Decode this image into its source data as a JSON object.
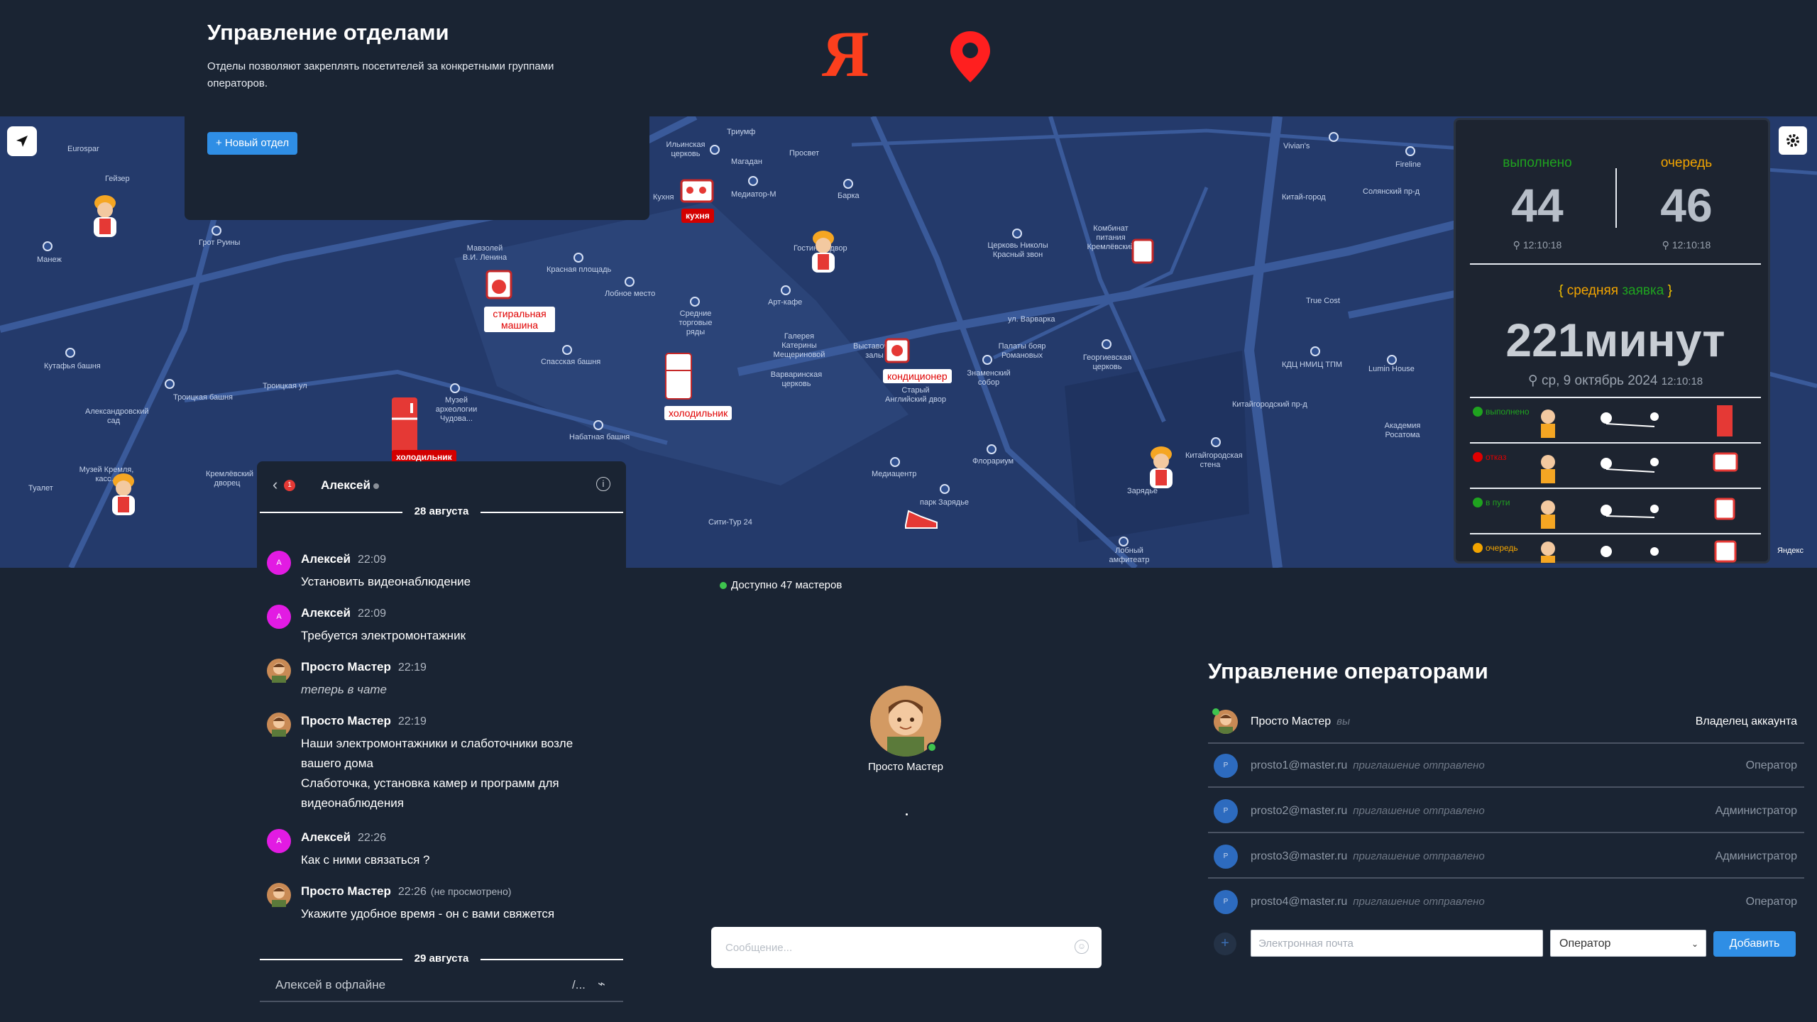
{
  "departments": {
    "title": "Управление отделами",
    "description": "Отделы позволяют закреплять посетителей за конкретными группами операторов.",
    "new_button": "+ Новый отдел"
  },
  "logos": {
    "yandex_letter": "Я"
  },
  "map": {
    "labels": [
      "Eurospar",
      "Гейзер",
      "Манеж",
      "Грот Руины",
      "Мавзолей В.И. Ленина",
      "Красная площадь",
      "Лобное место",
      "Средние торговые ряды",
      "Спасская башня",
      "Кутафья башня",
      "Александровский сад",
      "Троицкая башня",
      "Музей археологии Чудова...",
      "Набатная башня",
      "Музей Кремля, касс...",
      "Кремлёвский дворец",
      "Туалет",
      "Ильинская церковь",
      "Триумф",
      "Магадан",
      "Просвет",
      "Медиатор-М",
      "Барка",
      "Кухня",
      "Гостиный двор",
      "Арт-кафе",
      "Галерея Катерины Мещериновой",
      "Варваринская церковь",
      "Выставочные залы",
      "Старый Английский двор",
      "Знаменский собор",
      "Палаты бояр Романовых",
      "Церковь Николы Красный звон",
      "Комбинат питания Кремлёвский",
      "Георгиевская церковь",
      "Китай-город",
      "True Cost",
      "КДЦ НМИЦ ТПМ",
      "Lumin House",
      "Академия Росатома",
      "Зарядье",
      "Китайгородская стена",
      "Медиацентр",
      "Флорариум",
      "парк Зарядье",
      "Сити-Тур 24",
      "Лобный амфитеатр",
      "Vivian's",
      "Fireline",
      "Солянский пр-д",
      "ул. Варварка",
      "Троицкая ул",
      "Китайгородский пр-д",
      "Яндекс"
    ],
    "tags": {
      "washer": "стиральная машина",
      "fridge": "холодильник",
      "fridge2": "холодильник",
      "kitchen": "кухня",
      "aircon": "кондиционер"
    }
  },
  "stats": {
    "done_label": "выполнено",
    "queue_label": "очередь",
    "done_count": "44",
    "queue_count": "46",
    "done_time": "12:10:18",
    "queue_time": "12:10:18",
    "avg_label_part1": "средняя",
    "avg_label_part2": "заявка",
    "avg_value": "221минут",
    "avg_date": "ср, 9 октябрь 2024",
    "avg_time": "12:10:18",
    "rows": [
      {
        "status": "выполнено",
        "color": "#1fa31f"
      },
      {
        "status": "отказ",
        "color": "#e00000"
      },
      {
        "status": "в пути",
        "color": "#1fa31f"
      },
      {
        "status": "очередь",
        "color": "#f2a400"
      }
    ],
    "colors": {
      "done": "#1fa31f",
      "queue": "#f2a400"
    }
  },
  "chat": {
    "badge": "1",
    "contact_name": "Алексей",
    "date1": "28 августа",
    "date2": "29 августа",
    "messages": [
      {
        "author": "Алексей",
        "time": "22:09",
        "text": "Установить видеонаблюдение",
        "avatar_letter": "А"
      },
      {
        "author": "Алексей",
        "time": "22:09",
        "text": "Требуется электромонтажник",
        "avatar_letter": "А"
      },
      {
        "author": "Просто Мастер",
        "time": "22:19",
        "text": "теперь в чате"
      },
      {
        "author": "Просто Мастер",
        "time": "22:19",
        "text": "Наши электромонтажники и слаботочники возле вашего дома",
        "text2": "Слаботочка, установка камер и программ для видеонаблюдения"
      },
      {
        "author": "Алексей",
        "time": "22:26",
        "text": "Как с ними связаться ?",
        "avatar_letter": "А"
      },
      {
        "author": "Просто Мастер",
        "time": "22:26",
        "note": "(не просмотрено)",
        "text": "Укажите удобное время - он с вами свяжется"
      }
    ],
    "offline_status": "Алексей в офлайне",
    "command_hint": "/..."
  },
  "center": {
    "masters_available": "Доступно 47 мастеров",
    "operator_name": "Просто Мастер",
    "message_placeholder": "Сообщение..."
  },
  "operators": {
    "title": "Управление операторами",
    "rows": [
      {
        "email": "Просто Мастер",
        "sub": "вы",
        "role": "Владелец аккаунта"
      },
      {
        "email": "prosto1@master.ru",
        "sub": "приглашение отправлено",
        "role": "Оператор",
        "avatar_letter": "P"
      },
      {
        "email": "prosto2@master.ru",
        "sub": "приглашение отправлено",
        "role": "Администратор",
        "avatar_letter": "P"
      },
      {
        "email": "prosto3@master.ru",
        "sub": "приглашение отправлено",
        "role": "Администратор",
        "avatar_letter": "P"
      },
      {
        "email": "prosto4@master.ru",
        "sub": "приглашение отправлено",
        "role": "Оператор",
        "avatar_letter": "P"
      }
    ],
    "email_placeholder": "Электронная почта",
    "role_select": "Оператор",
    "add_button": "Добавить"
  }
}
